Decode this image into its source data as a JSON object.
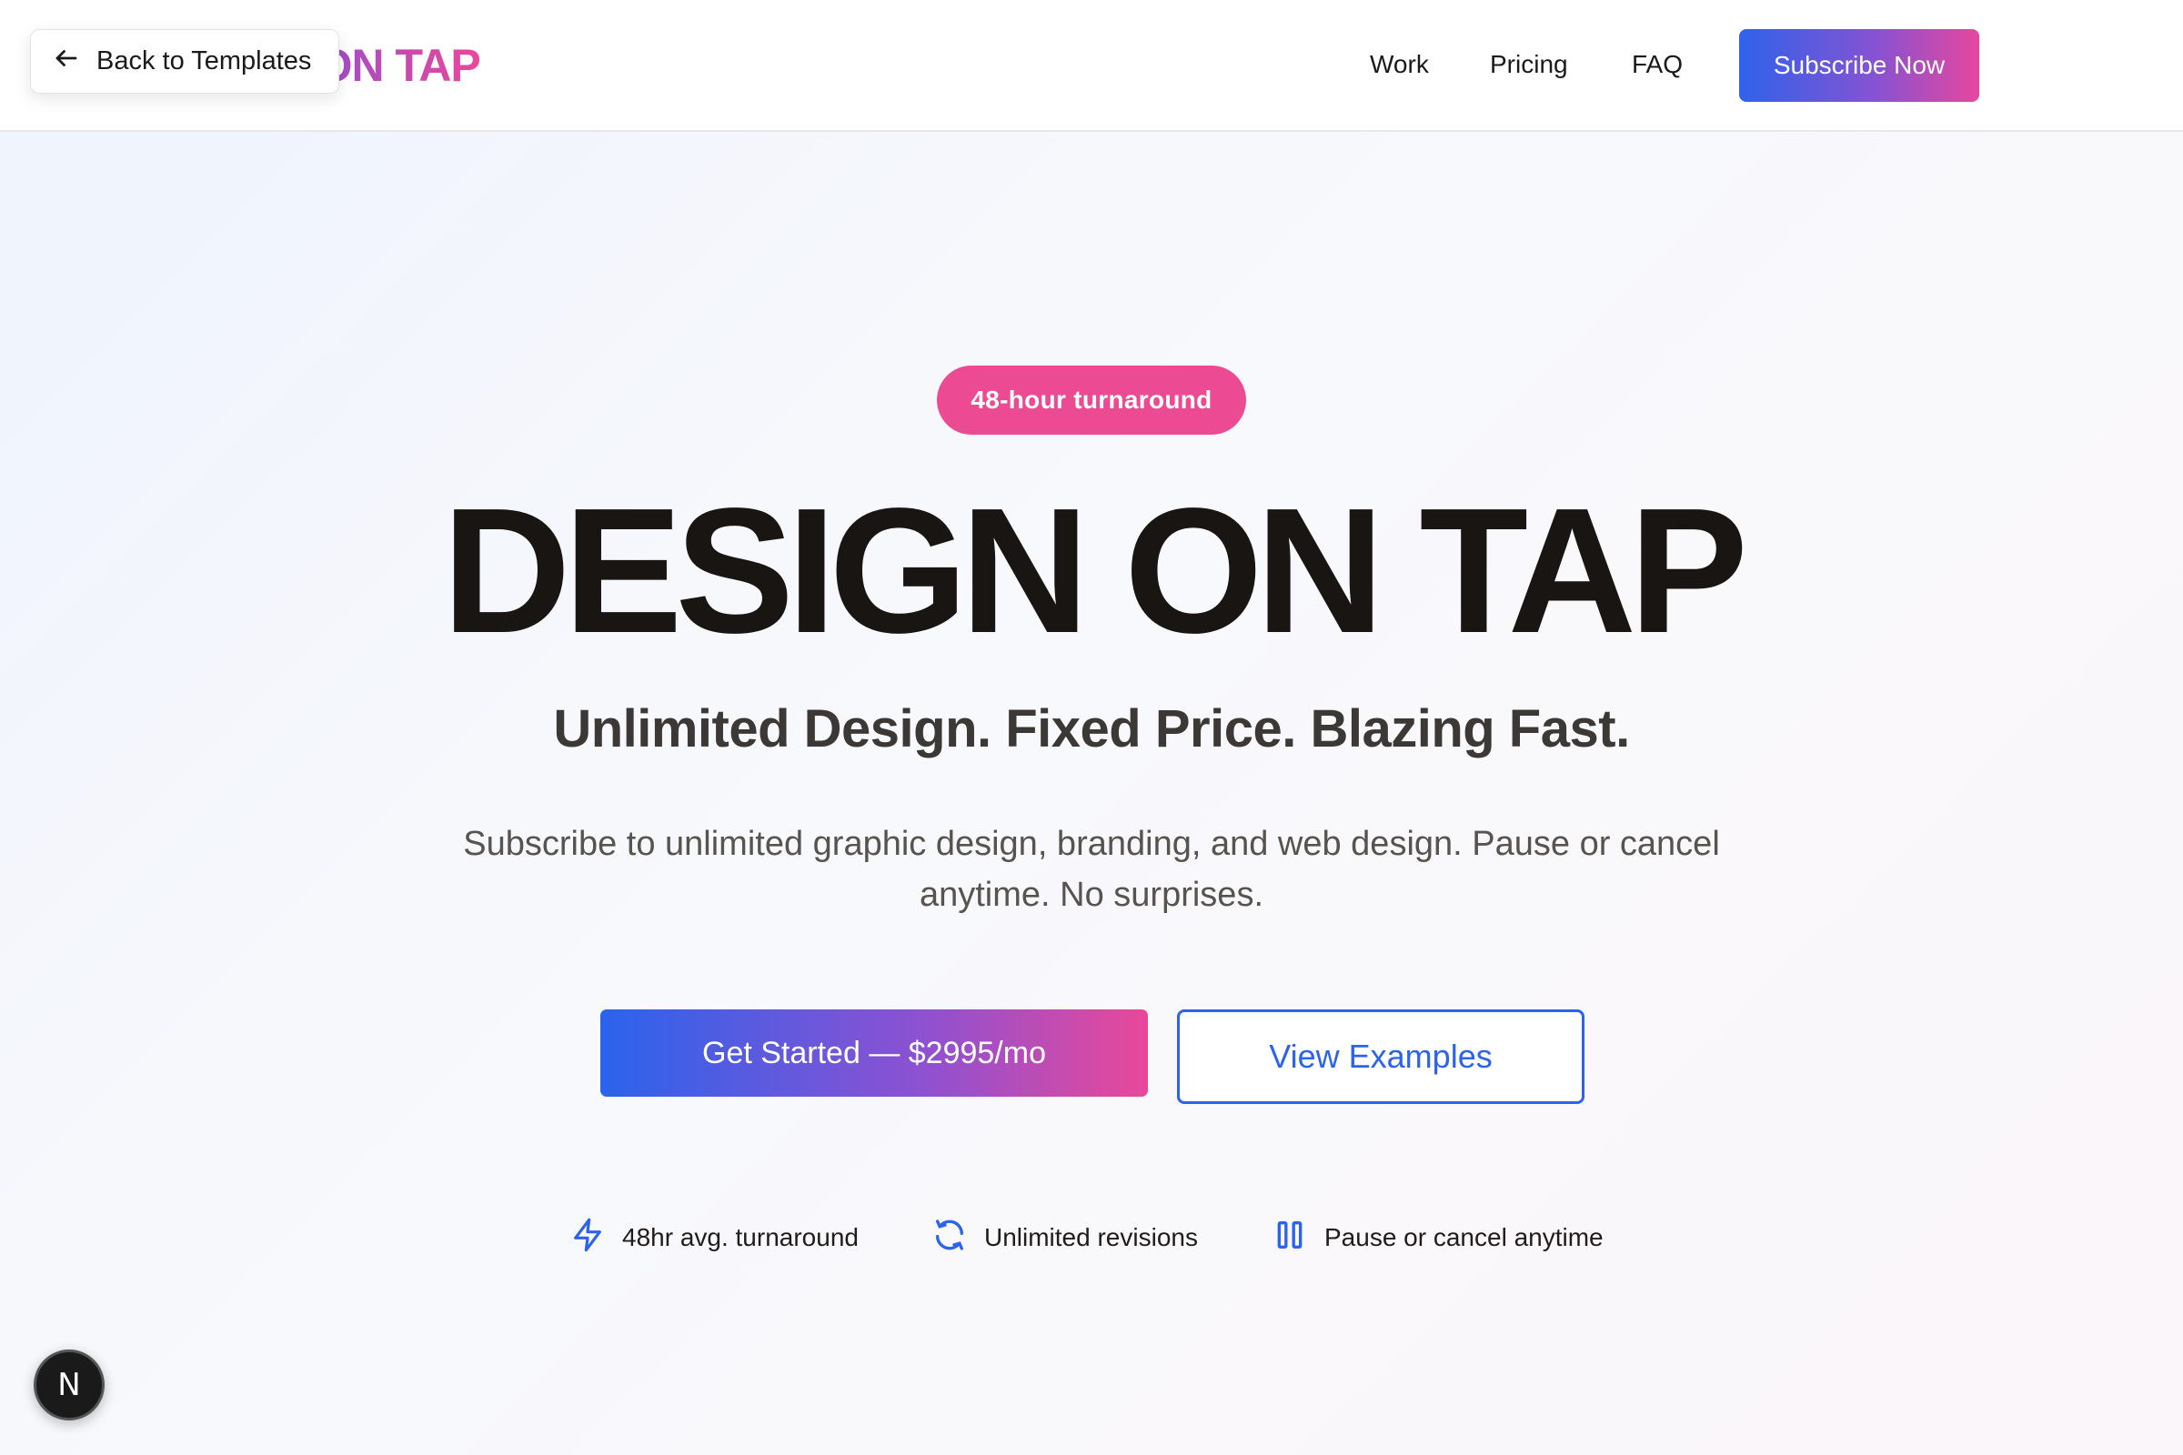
{
  "header": {
    "logo": "DESIGN ON TAP",
    "back_label": "Back to Templates",
    "nav": [
      "Work",
      "Pricing",
      "FAQ"
    ],
    "subscribe_label": "Subscribe Now"
  },
  "hero": {
    "badge": "48-hour turnaround",
    "title": "DESIGN ON TAP",
    "subtitle": "Unlimited Design. Fixed Price. Blazing Fast.",
    "description": "Subscribe to unlimited graphic design, branding, and web design. Pause or cancel anytime. No surprises.",
    "cta_primary": "Get Started — $2995/mo",
    "cta_secondary": "View Examples"
  },
  "features": [
    {
      "icon": "lightning-icon",
      "label": "48hr avg. turnaround"
    },
    {
      "icon": "refresh-icon",
      "label": "Unlimited revisions"
    },
    {
      "icon": "pause-icon",
      "label": "Pause or cancel anytime"
    }
  ],
  "dev_badge": "N",
  "colors": {
    "accent_blue": "#2b63ec",
    "accent_pink": "#ec4a93",
    "accent_purple": "#8f51d0"
  }
}
